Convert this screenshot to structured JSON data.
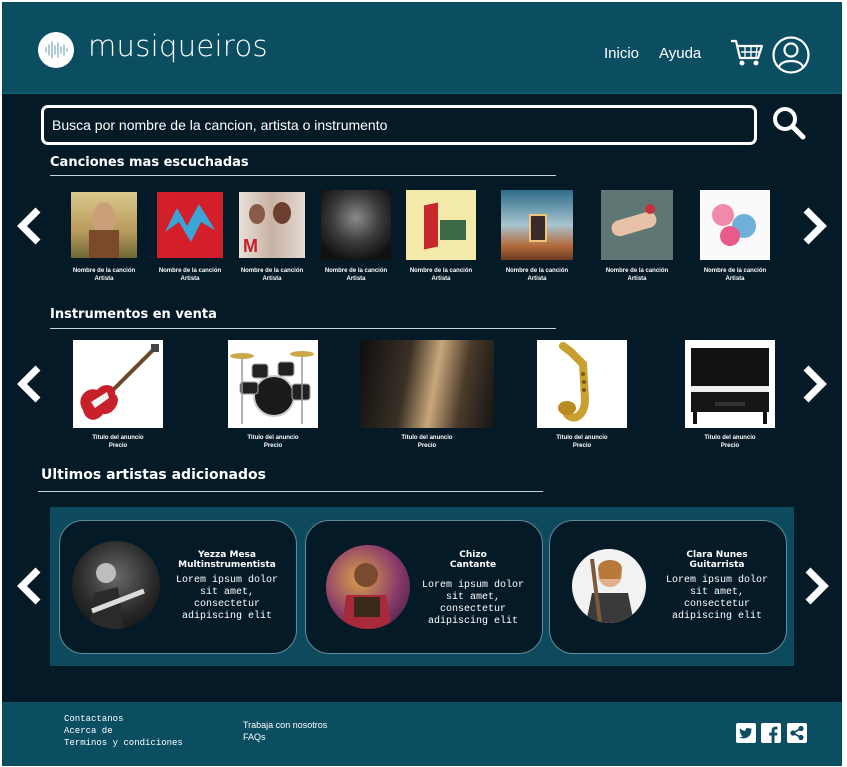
{
  "app": {
    "brand": "musiqueiros"
  },
  "nav": {
    "home": "Inicio",
    "help": "Ayuda"
  },
  "search": {
    "placeholder": "Busca por nombre de la cancion, artista o instrumento"
  },
  "songs_section": {
    "title": "Canciones mas escuchadas",
    "items": [
      {
        "name": "Nombre de la canción",
        "artist": "Artista"
      },
      {
        "name": "Nombre de la canción",
        "artist": "Artista"
      },
      {
        "name": "Nombre de la canción",
        "artist": "Artista"
      },
      {
        "name": "Nombre de la canción",
        "artist": "Artista"
      },
      {
        "name": "Nombre de la canción",
        "artist": "Artista"
      },
      {
        "name": "Nombre de la canción",
        "artist": "Artista"
      },
      {
        "name": "Nombre de la canción",
        "artist": "Artista"
      },
      {
        "name": "Nombre de la canción",
        "artist": "Artista"
      }
    ]
  },
  "instruments_section": {
    "title": "Instrumentos en venta",
    "items": [
      {
        "title": "Titulo del anuncio",
        "price": "Precio"
      },
      {
        "title": "Titulo del anuncio",
        "price": "Precio"
      },
      {
        "title": "Titulo del anuncio",
        "price": "Precio"
      },
      {
        "title": "Titulo del anuncio",
        "price": "Precio"
      },
      {
        "title": "Titulo del anuncio",
        "price": "Precio"
      }
    ]
  },
  "artists_section": {
    "title": "Ultimos artistas adicionados",
    "items": [
      {
        "name": "Yezza Mesa",
        "role": "Multinstrumentista",
        "desc": [
          "Lorem ipsum dolor",
          "sit amet,",
          "consectetur",
          "adipiscing elit"
        ]
      },
      {
        "name": "Chizo",
        "role": "Cantante",
        "desc": [
          "Lorem ipsum dolor",
          "sit amet,",
          "consectetur",
          "adipiscing elit"
        ]
      },
      {
        "name": "Clara Nunes",
        "role": "Guitarrista",
        "desc": [
          "Lorem ipsum dolor",
          "sit amet,",
          "consectetur",
          "adipiscing elit"
        ]
      }
    ]
  },
  "footer": {
    "col1": [
      "Contactanos",
      "Acerca de",
      "Terminos y condiciones"
    ],
    "col2": [
      "Trabaja con nosotros",
      "FAQs"
    ],
    "social": [
      "twitter-icon",
      "facebook-icon",
      "share-icon"
    ]
  },
  "colors": {
    "header": "#0b4d61",
    "background": "#041b27",
    "accent_band": "#0d4a5e"
  }
}
